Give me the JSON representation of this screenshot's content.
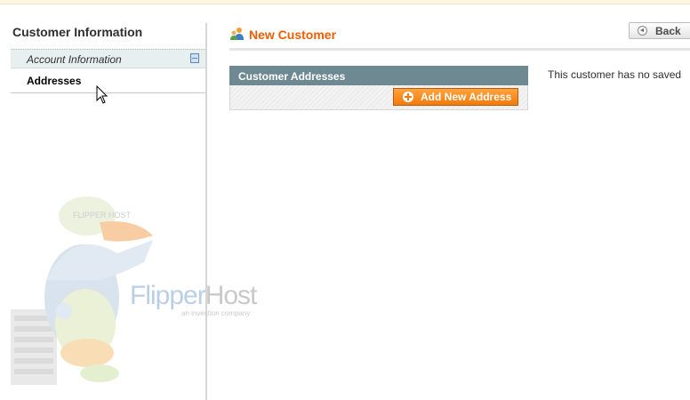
{
  "sidebar": {
    "title": "Customer Information",
    "tabs": [
      {
        "label": "Account Information"
      },
      {
        "label": "Addresses"
      }
    ]
  },
  "header": {
    "title": "New Customer",
    "back_label": "Back"
  },
  "addresses": {
    "section_title": "Customer Addresses",
    "add_button_label": "Add New Address",
    "empty_message": "This customer has no saved"
  },
  "watermark": {
    "brand_flipper": "Flipper",
    "brand_host": "Host",
    "tagline": "an investion company",
    "cap_text": "FLIPPER HOST"
  },
  "colors": {
    "accent": "#eb5e00",
    "panel_header": "#6f8992",
    "button_orange": "#f37a0c"
  }
}
